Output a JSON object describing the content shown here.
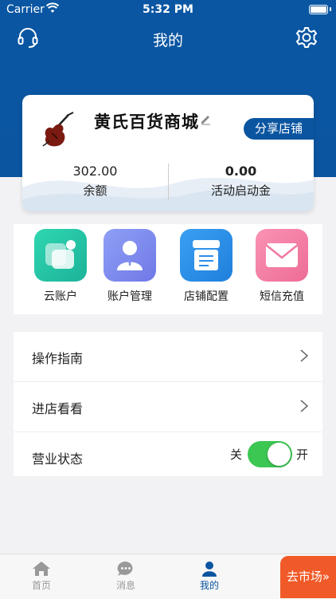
{
  "status_bar": {
    "carrier": "Carrier",
    "time": "5:32 PM"
  },
  "nav": {
    "title": "我的"
  },
  "shop": {
    "name": "黄氏百货商城",
    "share_label": "分享店铺"
  },
  "stats": [
    {
      "value": "302.00",
      "label": "余额"
    },
    {
      "value": "0.00",
      "label": "活动启动金"
    }
  ],
  "grid": [
    {
      "label": "云账户",
      "icon": "cloud-account-icon",
      "color": "#2ec7a6"
    },
    {
      "label": "账户管理",
      "icon": "account-manage-icon",
      "color": "#7f8ff0"
    },
    {
      "label": "店铺配置",
      "icon": "shop-config-icon",
      "color": "#2d8ee8"
    },
    {
      "label": "短信充值",
      "icon": "sms-recharge-icon",
      "color": "#f27aa2"
    }
  ],
  "menu": {
    "guide": "操作指南",
    "visit": "进店看看",
    "business_status": {
      "label": "营业状态",
      "off": "关",
      "on": "开",
      "enabled": true
    }
  },
  "tabbar": {
    "tabs": [
      {
        "label": "首页",
        "icon": "home-icon"
      },
      {
        "label": "消息",
        "icon": "message-icon"
      },
      {
        "label": "我的",
        "icon": "person-icon",
        "active": true
      }
    ],
    "market_label": "去市场"
  },
  "colors": {
    "brand": "#0b55a0",
    "accent": "#f05a28",
    "toggle_on": "#3cc652"
  }
}
